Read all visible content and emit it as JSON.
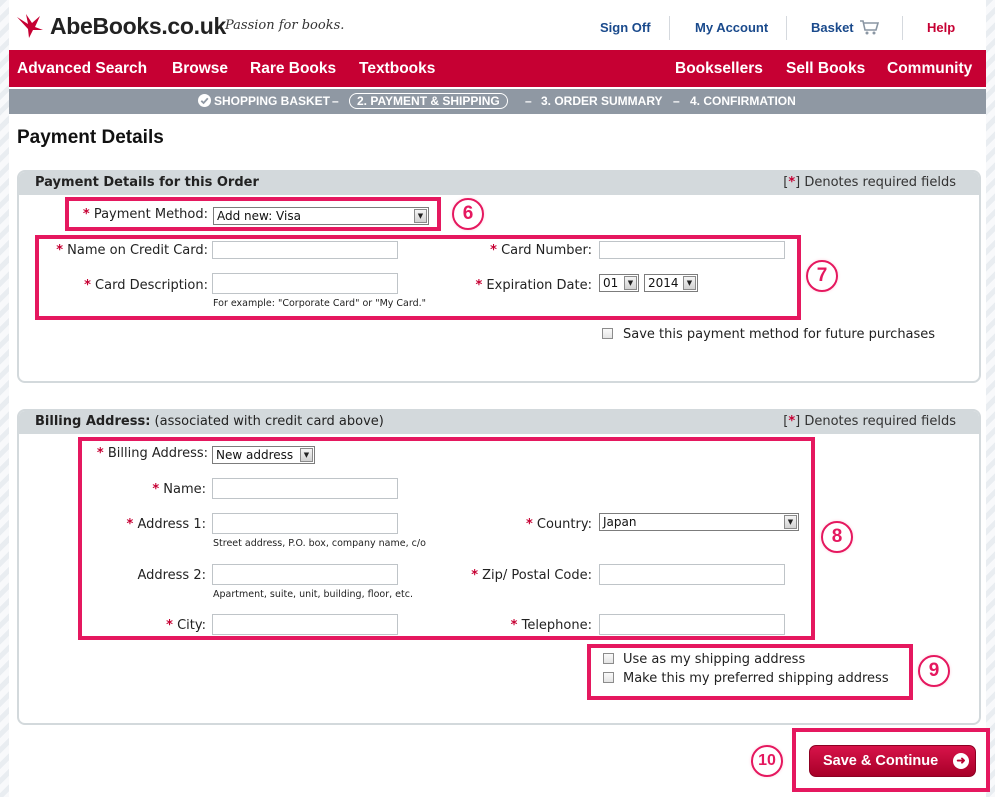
{
  "header": {
    "logo_text": "AbeBooks.co.uk",
    "tagline": "Passion for books.",
    "links": {
      "sign_off": "Sign Off",
      "my_account": "My Account",
      "basket": "Basket",
      "help": "Help"
    }
  },
  "nav": {
    "left": [
      "Advanced Search",
      "Browse",
      "Rare Books",
      "Textbooks"
    ],
    "right": [
      "Booksellers",
      "Sell Books",
      "Community"
    ]
  },
  "steps": {
    "step1": "SHOPPING BASKET",
    "dash": "–",
    "step2": "2. PAYMENT & SHIPPING",
    "step3": "3. ORDER SUMMARY",
    "step4": "4. CONFIRMATION"
  },
  "page_title": "Payment Details",
  "required_star": "*",
  "payment": {
    "header": "Payment Details for this Order",
    "required_note": "Denotes required fields",
    "payment_method_label": "Payment Method:",
    "payment_method_value": "Add new: Visa",
    "name_label": "Name on Credit Card:",
    "name_value": "",
    "card_number_label": "Card Number:",
    "card_number_value": "",
    "card_description_label": "Card Description:",
    "card_description_value": "",
    "card_description_hint": "For example: \"Corporate Card\" or \"My Card.\"",
    "expiration_label": "Expiration Date:",
    "exp_month": "01",
    "exp_year": "2014",
    "save_method_label": "Save this payment method for future purchases"
  },
  "billing": {
    "header_bold": "Billing Address:",
    "header_note": "(associated with credit card above)",
    "required_note": "Denotes required fields",
    "billing_address_label": "Billing Address:",
    "billing_address_value": "New address",
    "name_label": "Name:",
    "address1_label": "Address 1:",
    "address1_hint": "Street address, P.O. box, company name, c/o",
    "address2_label": "Address 2:",
    "address2_hint": "Apartment, suite, unit, building, floor, etc.",
    "city_label": "City:",
    "country_label": "Country:",
    "country_value": "Japan",
    "zip_label": "Zip/ Postal Code:",
    "telephone_label": "Telephone:",
    "use_shipping_label": "Use as my shipping address",
    "preferred_shipping_label": "Make this my preferred shipping address"
  },
  "button": {
    "save_continue": "Save & Continue"
  },
  "annotations": {
    "n6": "6",
    "n7": "7",
    "n8": "8",
    "n9": "9",
    "n10": "10"
  },
  "colors": {
    "brand": "#c60033",
    "steps_bar": "#8f98a3",
    "annotation": "#e5185f",
    "link": "#1a4a8c"
  },
  "icons": [
    "abebooks-bird-logo-icon",
    "cart-icon",
    "check-circle-icon",
    "arrow-right-circle-icon",
    "dropdown-arrow-icon"
  ]
}
